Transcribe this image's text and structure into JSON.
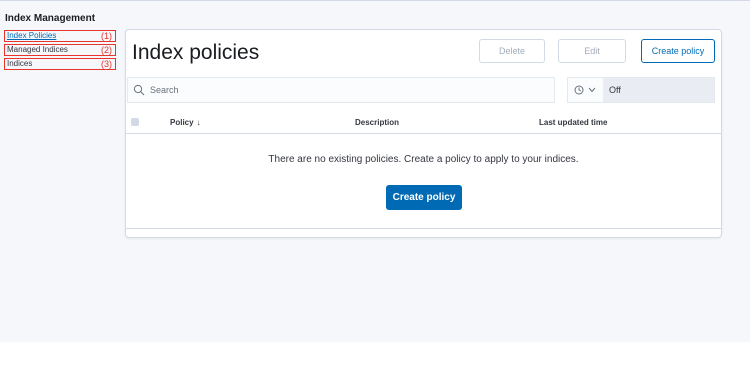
{
  "sidebar": {
    "title": "Index Management",
    "items": [
      {
        "label": "Index Policies",
        "marker": "(1)",
        "active": true
      },
      {
        "label": "Managed Indices",
        "marker": "(2)",
        "active": false
      },
      {
        "label": "Indices",
        "marker": "(3)",
        "active": false
      }
    ]
  },
  "main": {
    "title": "Index policies",
    "buttons": {
      "delete": "Delete",
      "edit": "Edit",
      "create": "Create policy"
    },
    "search": {
      "placeholder": "Search",
      "value": ""
    },
    "refresh": {
      "value": "Off"
    },
    "table": {
      "columns": [
        "Policy",
        "Description",
        "Last updated time"
      ],
      "sort_indicator": "↓",
      "empty_message": "There are no existing policies. Create a policy to apply to your indices."
    },
    "empty_action": "Create policy"
  },
  "colors": {
    "accent": "#006bb4",
    "annotation_red": "#e7342d",
    "page_bg": "#f5f7fa"
  },
  "icons": [
    "search-icon",
    "clock-icon",
    "chevron-down-icon",
    "sort-arrow-icon"
  ]
}
